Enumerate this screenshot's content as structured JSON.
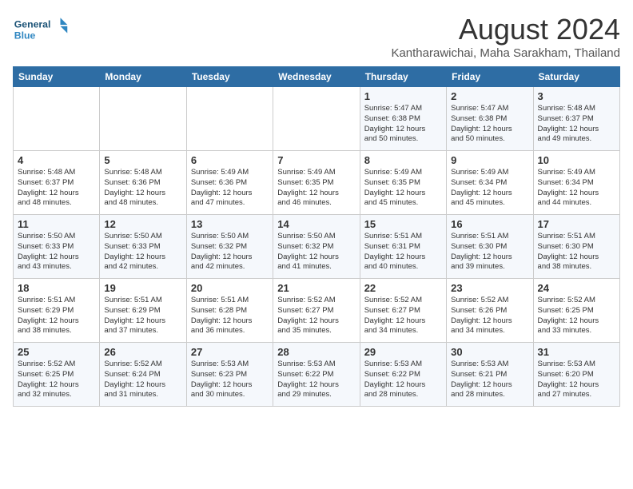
{
  "header": {
    "logo_line1": "General",
    "logo_line2": "Blue",
    "month_year": "August 2024",
    "location": "Kantharawichai, Maha Sarakham, Thailand"
  },
  "days_of_week": [
    "Sunday",
    "Monday",
    "Tuesday",
    "Wednesday",
    "Thursday",
    "Friday",
    "Saturday"
  ],
  "weeks": [
    [
      {
        "day": "",
        "detail": ""
      },
      {
        "day": "",
        "detail": ""
      },
      {
        "day": "",
        "detail": ""
      },
      {
        "day": "",
        "detail": ""
      },
      {
        "day": "1",
        "detail": "Sunrise: 5:47 AM\nSunset: 6:38 PM\nDaylight: 12 hours\nand 50 minutes."
      },
      {
        "day": "2",
        "detail": "Sunrise: 5:47 AM\nSunset: 6:38 PM\nDaylight: 12 hours\nand 50 minutes."
      },
      {
        "day": "3",
        "detail": "Sunrise: 5:48 AM\nSunset: 6:37 PM\nDaylight: 12 hours\nand 49 minutes."
      }
    ],
    [
      {
        "day": "4",
        "detail": "Sunrise: 5:48 AM\nSunset: 6:37 PM\nDaylight: 12 hours\nand 48 minutes."
      },
      {
        "day": "5",
        "detail": "Sunrise: 5:48 AM\nSunset: 6:36 PM\nDaylight: 12 hours\nand 48 minutes."
      },
      {
        "day": "6",
        "detail": "Sunrise: 5:49 AM\nSunset: 6:36 PM\nDaylight: 12 hours\nand 47 minutes."
      },
      {
        "day": "7",
        "detail": "Sunrise: 5:49 AM\nSunset: 6:35 PM\nDaylight: 12 hours\nand 46 minutes."
      },
      {
        "day": "8",
        "detail": "Sunrise: 5:49 AM\nSunset: 6:35 PM\nDaylight: 12 hours\nand 45 minutes."
      },
      {
        "day": "9",
        "detail": "Sunrise: 5:49 AM\nSunset: 6:34 PM\nDaylight: 12 hours\nand 45 minutes."
      },
      {
        "day": "10",
        "detail": "Sunrise: 5:49 AM\nSunset: 6:34 PM\nDaylight: 12 hours\nand 44 minutes."
      }
    ],
    [
      {
        "day": "11",
        "detail": "Sunrise: 5:50 AM\nSunset: 6:33 PM\nDaylight: 12 hours\nand 43 minutes."
      },
      {
        "day": "12",
        "detail": "Sunrise: 5:50 AM\nSunset: 6:33 PM\nDaylight: 12 hours\nand 42 minutes."
      },
      {
        "day": "13",
        "detail": "Sunrise: 5:50 AM\nSunset: 6:32 PM\nDaylight: 12 hours\nand 42 minutes."
      },
      {
        "day": "14",
        "detail": "Sunrise: 5:50 AM\nSunset: 6:32 PM\nDaylight: 12 hours\nand 41 minutes."
      },
      {
        "day": "15",
        "detail": "Sunrise: 5:51 AM\nSunset: 6:31 PM\nDaylight: 12 hours\nand 40 minutes."
      },
      {
        "day": "16",
        "detail": "Sunrise: 5:51 AM\nSunset: 6:30 PM\nDaylight: 12 hours\nand 39 minutes."
      },
      {
        "day": "17",
        "detail": "Sunrise: 5:51 AM\nSunset: 6:30 PM\nDaylight: 12 hours\nand 38 minutes."
      }
    ],
    [
      {
        "day": "18",
        "detail": "Sunrise: 5:51 AM\nSunset: 6:29 PM\nDaylight: 12 hours\nand 38 minutes."
      },
      {
        "day": "19",
        "detail": "Sunrise: 5:51 AM\nSunset: 6:29 PM\nDaylight: 12 hours\nand 37 minutes."
      },
      {
        "day": "20",
        "detail": "Sunrise: 5:51 AM\nSunset: 6:28 PM\nDaylight: 12 hours\nand 36 minutes."
      },
      {
        "day": "21",
        "detail": "Sunrise: 5:52 AM\nSunset: 6:27 PM\nDaylight: 12 hours\nand 35 minutes."
      },
      {
        "day": "22",
        "detail": "Sunrise: 5:52 AM\nSunset: 6:27 PM\nDaylight: 12 hours\nand 34 minutes."
      },
      {
        "day": "23",
        "detail": "Sunrise: 5:52 AM\nSunset: 6:26 PM\nDaylight: 12 hours\nand 34 minutes."
      },
      {
        "day": "24",
        "detail": "Sunrise: 5:52 AM\nSunset: 6:25 PM\nDaylight: 12 hours\nand 33 minutes."
      }
    ],
    [
      {
        "day": "25",
        "detail": "Sunrise: 5:52 AM\nSunset: 6:25 PM\nDaylight: 12 hours\nand 32 minutes."
      },
      {
        "day": "26",
        "detail": "Sunrise: 5:52 AM\nSunset: 6:24 PM\nDaylight: 12 hours\nand 31 minutes."
      },
      {
        "day": "27",
        "detail": "Sunrise: 5:53 AM\nSunset: 6:23 PM\nDaylight: 12 hours\nand 30 minutes."
      },
      {
        "day": "28",
        "detail": "Sunrise: 5:53 AM\nSunset: 6:22 PM\nDaylight: 12 hours\nand 29 minutes."
      },
      {
        "day": "29",
        "detail": "Sunrise: 5:53 AM\nSunset: 6:22 PM\nDaylight: 12 hours\nand 28 minutes."
      },
      {
        "day": "30",
        "detail": "Sunrise: 5:53 AM\nSunset: 6:21 PM\nDaylight: 12 hours\nand 28 minutes."
      },
      {
        "day": "31",
        "detail": "Sunrise: 5:53 AM\nSunset: 6:20 PM\nDaylight: 12 hours\nand 27 minutes."
      }
    ]
  ]
}
